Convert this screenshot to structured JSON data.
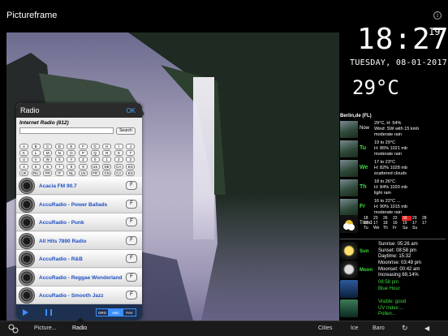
{
  "app": {
    "title": "Pictureframe"
  },
  "clock": {
    "hm": "18:27",
    "seconds": "19",
    "date": "TUESDAY, 08-01-2017",
    "temperature": "29°C"
  },
  "weather": {
    "location": "Berlin,de (FL)",
    "rows": [
      {
        "day": "Now",
        "lines": [
          "29°C, H: 54%",
          "Wind: SW with 15 kmh",
          "moderate rain"
        ],
        "green": false
      },
      {
        "day": "Tu",
        "lines": [
          "19 to 29°C",
          "H: 86% 1021 mb",
          "moderate rain"
        ],
        "green": true
      },
      {
        "day": "We",
        "lines": [
          "17 to 23°C",
          "H: 82% 1028 mb",
          "scattered clouds"
        ],
        "green": true
      },
      {
        "day": "Th",
        "lines": [
          "18 to 26°C",
          "H: 84% 1020 mb",
          "light rain"
        ],
        "green": true
      },
      {
        "day": "Fr",
        "lines": [
          "16 to 22°C ...",
          "H: 90% 1015 mb",
          "moderate rain"
        ],
        "green": true
      }
    ],
    "trend": {
      "label": "Trend",
      "temps": [
        "18",
        "23",
        "26",
        "22",
        "30",
        "29",
        "28"
      ],
      "lows": [
        "20",
        "17",
        "18",
        "16",
        "19",
        "17",
        "17"
      ],
      "days": [
        "Tu",
        "We",
        "Th",
        "Fr",
        "Sa",
        "Su",
        ""
      ],
      "highlight_index": 4
    }
  },
  "astro": [
    {
      "tag": "Sun",
      "lines": [
        "Sunrise: 05:26 am",
        "Sunset: 08:58 pm",
        "Daytime: 15:32"
      ],
      "green": false
    },
    {
      "tag": "Moon",
      "lines": [
        "Moonrise: 03:48 pm",
        "Moonset: 00:42 am",
        "Increasing 69,14%"
      ],
      "green": false
    },
    {
      "tag": "",
      "lines": [
        "08:58 pm",
        "Blue Hour"
      ],
      "green": true
    },
    {
      "tag": "",
      "lines": [
        "Visible: good",
        "UV Index:...",
        "Pollen..."
      ],
      "green": true
    }
  ],
  "radio": {
    "title": "Radio",
    "ok": "OK",
    "subtitle": "Internet Radio (812)",
    "search_placeholder": "",
    "search_button": "Search",
    "keys": [
      [
        "A",
        "B",
        "C",
        "D",
        "E",
        "F",
        "G",
        "H",
        "I",
        "J"
      ],
      [
        "K",
        "L",
        "M",
        "N",
        "O",
        "P",
        "Q",
        "R",
        "S",
        "T"
      ],
      [
        "U",
        "V",
        "W",
        "X",
        "Y",
        "Z",
        "0",
        "1",
        "2",
        "3"
      ],
      [
        "4",
        "5",
        "6",
        "7",
        "8",
        "9",
        "US",
        "DE",
        "CA",
        "ES"
      ],
      [
        "UK",
        "RU",
        "FR",
        "IT",
        "NL",
        "LN",
        "FR",
        "CN",
        "CA",
        "ES"
      ]
    ],
    "stations": [
      "Acacia FM 90.7",
      "AccuRadio - Power Ballads",
      "AccuRadio - Punk",
      "All Hits 7890 Radio",
      "AccuRadio - R&B",
      "AccuRadio - Reggae Wonderland",
      "AccuRadio - Smooth Jazz"
    ],
    "fav_label": "F",
    "segments": [
      "ORG",
      "ABC",
      "FAV"
    ]
  },
  "bottombar": {
    "items": [
      "Picture...",
      "Radio",
      "Cities",
      "Ice",
      "Baro"
    ]
  }
}
